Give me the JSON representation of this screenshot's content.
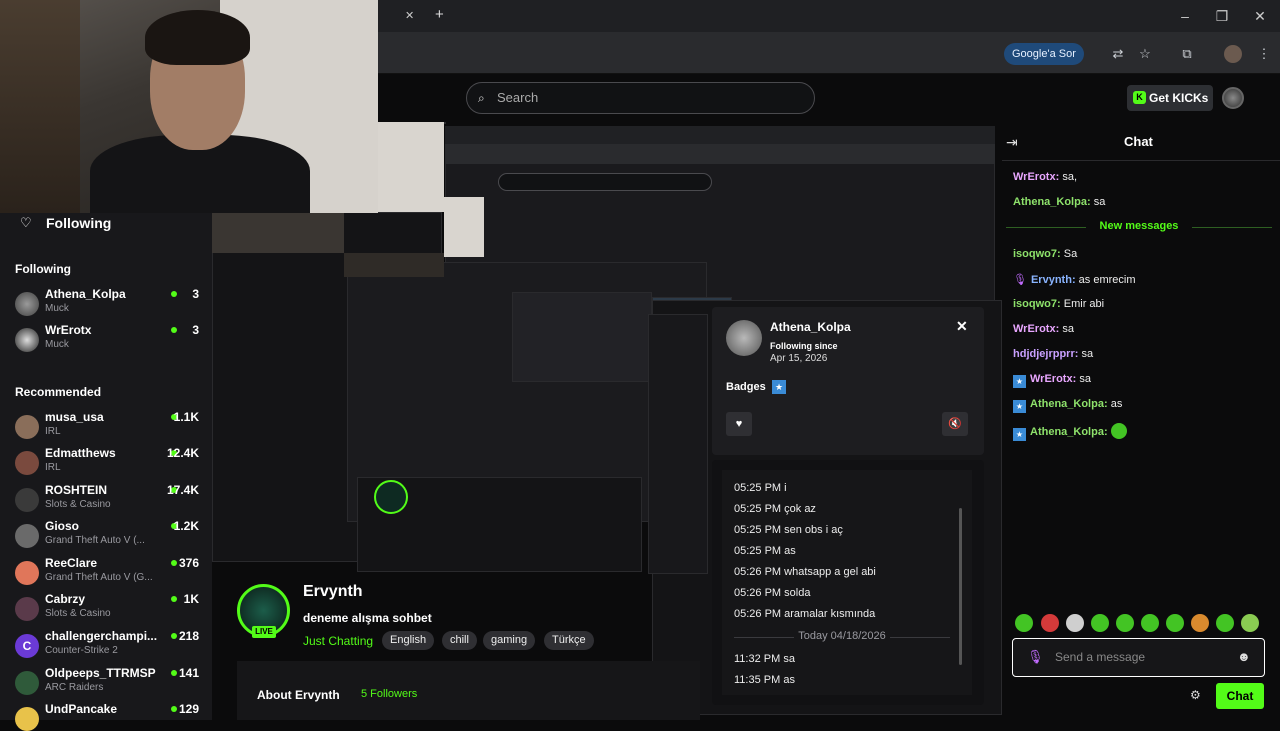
{
  "browser": {
    "new_tab": "+",
    "close_tab": "✕",
    "win_min": "–",
    "win_max": "❐",
    "win_close": "✕",
    "google_sor": "Google'a Sor"
  },
  "header": {
    "search_placeholder": "Search",
    "get_kicks": "Get KICKs"
  },
  "sidebar": {
    "following_header": "Following",
    "following_section": "Following",
    "following": [
      {
        "name": "Athena_Kolpa",
        "sub": "Muck",
        "viewers": "3"
      },
      {
        "name": "WrErotx",
        "sub": "Muck",
        "viewers": "3"
      }
    ],
    "recommended_section": "Recommended",
    "recommended": [
      {
        "name": "musa_usa",
        "sub": "IRL",
        "viewers": "1.1K"
      },
      {
        "name": "Edmatthews",
        "sub": "IRL",
        "viewers": "12.4K"
      },
      {
        "name": "ROSHTEIN",
        "sub": "Slots & Casino",
        "viewers": "17.4K"
      },
      {
        "name": "Gioso",
        "sub": "Grand Theft Auto V (...",
        "viewers": "1.2K"
      },
      {
        "name": "ReeClare",
        "sub": "Grand Theft Auto V (G...",
        "viewers": "376"
      },
      {
        "name": "Cabrzy",
        "sub": "Slots & Casino",
        "viewers": "1K"
      },
      {
        "name": "challengerchampi...",
        "sub": "Counter-Strike 2",
        "viewers": "218"
      },
      {
        "name": "Oldpeeps_TTRMSP",
        "sub": "ARC Raiders",
        "viewers": "141"
      },
      {
        "name": "UndPancake",
        "sub": "",
        "viewers": "129"
      }
    ]
  },
  "popup": {
    "name": "Athena_Kolpa",
    "following_since_label": "Following since",
    "following_since_date": "Apr 15, 2026",
    "badges_label": "Badges",
    "close": "✕",
    "heart": "♥",
    "mute": "🔇"
  },
  "history": {
    "lines": [
      "05:25 PM i",
      "05:25 PM çok az",
      "05:25 PM sen obs i aç",
      "05:25 PM as",
      "05:26 PM whatsapp a gel abi",
      "05:26 PM solda",
      "05:26 PM aramalar kısmında"
    ],
    "separator": "Today 04/18/2026",
    "later": [
      "11:32 PM sa",
      "11:35 PM as"
    ]
  },
  "stream": {
    "name": "Ervynth",
    "live": "LIVE",
    "title": "deneme alışma sohbet",
    "category": "Just Chatting",
    "tags": [
      "English",
      "chill",
      "gaming",
      "Türkçe"
    ],
    "about_label": "About Ervynth",
    "followers": "5 Followers"
  },
  "chat": {
    "title": "Chat",
    "new_messages": "New messages",
    "messages": [
      {
        "user": "WrErotx",
        "text": " sa,",
        "color": "#e9a7ff",
        "badge": false,
        "mic": false
      },
      {
        "user": "Athena_Kolpa",
        "text": " sa",
        "color": "#8ee26b",
        "badge": false,
        "mic": false
      },
      {
        "user": "isoqwo7",
        "text": " Sa",
        "color": "#8ee26b",
        "badge": false,
        "mic": false
      },
      {
        "user": "Ervynth",
        "text": " as emrecim",
        "color": "#8ab4ff",
        "badge": false,
        "mic": true
      },
      {
        "user": "isoqwo7",
        "text": " Emir abi",
        "color": "#8ee26b",
        "badge": false,
        "mic": false
      },
      {
        "user": "WrErotx",
        "text": " sa",
        "color": "#e9a7ff",
        "badge": false,
        "mic": false
      },
      {
        "user": "hdjdjejrpprr",
        "text": " sa",
        "color": "#c9a0ff",
        "badge": false,
        "mic": false
      },
      {
        "user": "WrErotx",
        "text": " sa",
        "color": "#e9a7ff",
        "badge": true,
        "mic": false
      },
      {
        "user": "Athena_Kolpa",
        "text": " as",
        "color": "#8ee26b",
        "badge": true,
        "mic": false
      },
      {
        "user": "Athena_Kolpa",
        "text": "",
        "color": "#8ee26b",
        "badge": true,
        "mic": false
      }
    ],
    "input_placeholder": "Send a message",
    "send_label": "Chat"
  },
  "colors": {
    "accent": "#53fc18",
    "background": "#0b0b0c",
    "panel": "#18181b"
  }
}
